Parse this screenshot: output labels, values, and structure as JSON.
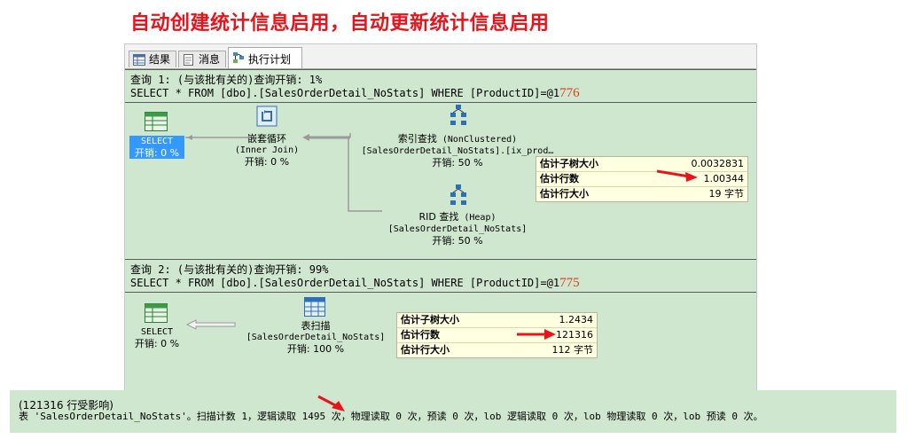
{
  "heading": "自动创建统计信息启用，自动更新统计信息启用",
  "tabs": [
    {
      "label": "结果",
      "icon": "grid-icon"
    },
    {
      "label": "消息",
      "icon": "message-icon"
    },
    {
      "label": "执行计划",
      "icon": "execution-plan-icon"
    }
  ],
  "query1": {
    "header": "查询 1: (与该批有关的)查询开销: 1%",
    "sql": "SELECT * FROM [dbo].[SalesOrderDetail_NoStats] WHERE [ProductID]=@1",
    "annotation": "776",
    "ops": {
      "select": {
        "name": "SELECT",
        "cost": "开销: 0 %"
      },
      "nested_loops": {
        "name": "嵌套循环",
        "sub": "(Inner Join)",
        "cost": "开销: 0 %"
      },
      "index_seek": {
        "name": "索引查找",
        "sub": "(NonClustered)",
        "obj": "[SalesOrderDetail_NoStats].[ix_prod…",
        "cost": "开销: 50 %"
      },
      "rid_lookup": {
        "name": "RID 查找",
        "sub": "(Heap)",
        "obj": "[SalesOrderDetail_NoStats]",
        "cost": "开销: 50 %"
      }
    },
    "tooltip": [
      {
        "label": "估计子树大小",
        "value": "0.0032831"
      },
      {
        "label": "估计行数",
        "value": "1.00344"
      },
      {
        "label": "估计行大小",
        "value": "19 字节"
      }
    ]
  },
  "query2": {
    "header": "查询 2: (与该批有关的)查询开销: 99%",
    "sql": "SELECT * FROM [dbo].[SalesOrderDetail_NoStats] WHERE [ProductID]=@1",
    "annotation": "775",
    "ops": {
      "select": {
        "name": "SELECT",
        "cost": "开销: 0 %"
      },
      "table_scan": {
        "name": "表扫描",
        "obj": "[SalesOrderDetail_NoStats]",
        "cost": "开销: 100 %"
      }
    },
    "tooltip": [
      {
        "label": "估计子树大小",
        "value": "1.2434"
      },
      {
        "label": "估计行数",
        "value": "121316"
      },
      {
        "label": "估计行大小",
        "value": "112 字节"
      }
    ]
  },
  "messages": {
    "line1": "(121316 行受影响)",
    "line2": "表 'SalesOrderDetail_NoStats'。扫描计数 1，逻辑读取 1495 次，物理读取 0 次，预读 0 次，lob 逻辑读取 0 次，lob 物理读取 0 次，lob 预读 0 次。"
  },
  "colors": {
    "heading": "#e8141b",
    "plan_background": "#cfe6cf",
    "tooltip_background": "#ffffe1",
    "annotation_arrow": "#e8141b",
    "selected_operator": "#3399ff"
  }
}
